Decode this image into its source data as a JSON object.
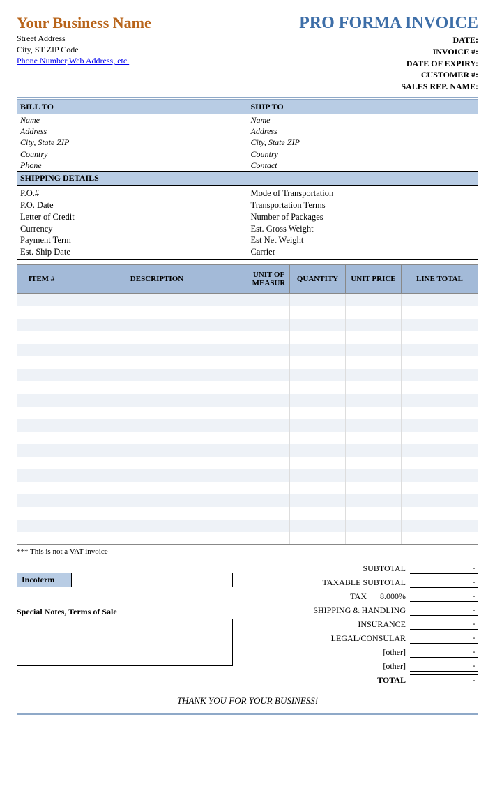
{
  "business": {
    "name": "Your Business Name",
    "street": "Street Address",
    "city": "City, ST  ZIP Code",
    "link": "Phone Number,Web Address, etc."
  },
  "doc_title": "PRO FORMA INVOICE",
  "meta": {
    "date": "DATE:",
    "invoice": "INVOICE #:",
    "expiry": "DATE OF EXPIRY:",
    "customer": "CUSTOMER #:",
    "salesrep": "SALES REP. NAME:"
  },
  "bill_to": {
    "title": "BILL TO",
    "fields": [
      "Name",
      "Address",
      "City, State ZIP",
      "Country",
      "Phone"
    ]
  },
  "ship_to": {
    "title": "SHIP TO",
    "fields": [
      "Name",
      "Address",
      "City, State ZIP",
      "Country",
      "Contact"
    ]
  },
  "shipping": {
    "title": "SHIPPING DETAILS",
    "left": [
      "P.O.#",
      "P.O. Date",
      "Letter of Credit",
      "Currency",
      "Payment Term",
      "Est. Ship Date"
    ],
    "right": [
      "Mode of Transportation",
      "Transportation Terms",
      "Number of Packages",
      "Est. Gross Weight",
      "Est Net Weight",
      "Carrier"
    ]
  },
  "columns": {
    "item": "ITEM #",
    "desc": "DESCRIPTION",
    "uom": "UNIT OF MEASUR",
    "qty": "QUANTITY",
    "price": "UNIT PRICE",
    "total": "LINE TOTAL"
  },
  "vat_note": "*** This is not a VAT invoice",
  "incoterm": "Incoterm",
  "notes_label": "Special Notes, Terms of Sale",
  "totals": {
    "subtotal": "SUBTOTAL",
    "taxable": "TAXABLE SUBTOTAL",
    "tax": "TAX",
    "tax_rate": "8.000%",
    "shipping": "SHIPPING & HANDLING",
    "insurance": "INSURANCE",
    "legal": "LEGAL/CONSULAR",
    "other1": "[other]",
    "other2": "[other]",
    "total": "TOTAL"
  },
  "thank_you": "THANK YOU FOR YOUR BUSINESS!"
}
